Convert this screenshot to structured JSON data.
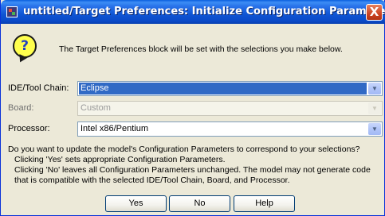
{
  "window": {
    "title": "untitled/Target Preferences: Initialize Configuration Parameters",
    "close_glyph": "X"
  },
  "icons": {
    "app": "simulink-app-icon",
    "info": "question-icon",
    "info_glyph": "?"
  },
  "intro_text": "The Target Preferences block will be set with the selections you make below.",
  "fields": [
    {
      "label": "IDE/Tool Chain:",
      "value": "Eclipse",
      "enabled": true,
      "highlighted": true
    },
    {
      "label": "Board:",
      "value": "Custom",
      "enabled": false,
      "highlighted": false
    },
    {
      "label": "Processor:",
      "value": "Intel x86/Pentium",
      "enabled": true,
      "highlighted": false
    }
  ],
  "question": {
    "lines": [
      "Do you want to update the model's Configuration Parameters to correspond to your selections?",
      "Clicking 'Yes' sets appropriate Configuration Parameters.",
      "Clicking 'No' leaves all Configuration Parameters unchanged.  The model may not generate code",
      "that is compatible with the selected IDE/Tool Chain, Board, and Processor."
    ]
  },
  "buttons": {
    "yes": "Yes",
    "no": "No",
    "help": "Help"
  },
  "dropdown_glyph": "▼"
}
